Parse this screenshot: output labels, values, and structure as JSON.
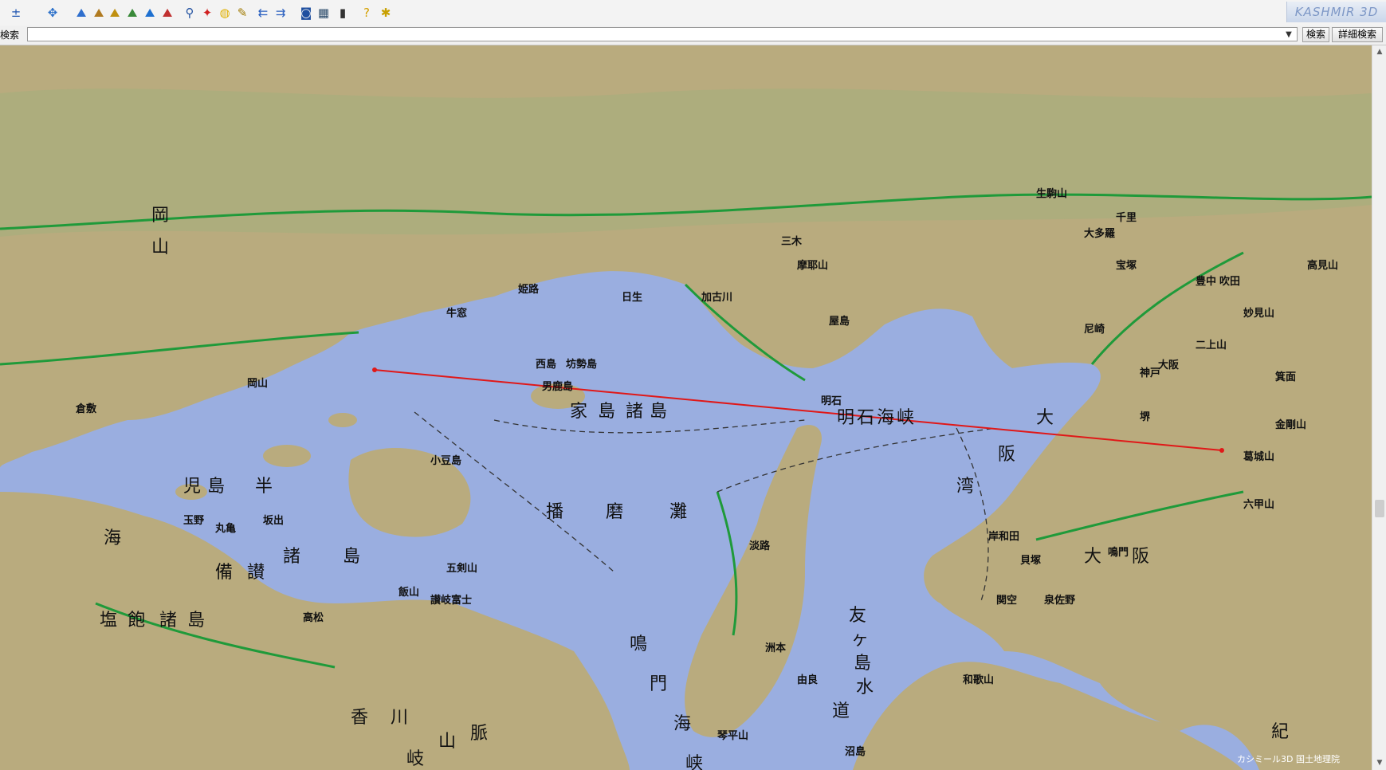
{
  "toolbar": {
    "buttons": [
      {
        "icon": "zoom-search-icon",
        "glyph": "±",
        "color": "#1f55b0",
        "label": ""
      },
      {
        "icon": "cursor-icon",
        "glyph": "✥",
        "color": "#2a6fc9",
        "label": ""
      },
      {
        "icon": "terrain-view-1-icon",
        "glyph": "⛰",
        "color": "#2f6fcd",
        "label": ""
      },
      {
        "icon": "terrain-view-2-icon",
        "glyph": "⛰",
        "color": "#b07a20",
        "label": ""
      },
      {
        "icon": "terrain-view-3-icon",
        "glyph": "⛰",
        "color": "#c09010",
        "label": ""
      },
      {
        "icon": "terrain-view-4-icon",
        "glyph": "⛰",
        "color": "#3a8a3a",
        "label": ""
      },
      {
        "icon": "terrain-view-5-icon",
        "glyph": "⛰",
        "color": "#1e70d0",
        "label": ""
      },
      {
        "icon": "terrain-view-6-icon",
        "glyph": "⛰",
        "color": "#c03030",
        "label": ""
      },
      {
        "icon": "binoculars-icon",
        "glyph": "⚲",
        "color": "#2050a0",
        "label": ""
      },
      {
        "icon": "paint-icon",
        "glyph": "✦",
        "color": "#d02020",
        "label": ""
      },
      {
        "icon": "palette-icon",
        "glyph": "◍",
        "color": "#e0b000",
        "label": ""
      },
      {
        "icon": "pencil-icon",
        "glyph": "✎",
        "color": "#a07a00",
        "label": ""
      },
      {
        "icon": "back-arrow-icon",
        "glyph": "⇇",
        "color": "#2a60c0",
        "label": ""
      },
      {
        "icon": "forward-arrow-icon",
        "glyph": "⇉",
        "color": "#2a60c0",
        "label": ""
      },
      {
        "icon": "camera-icon",
        "glyph": "◙",
        "color": "#1f4f9f",
        "label": ""
      },
      {
        "icon": "film-icon",
        "glyph": "▦",
        "color": "#2a4a6a",
        "label": ""
      },
      {
        "icon": "device-icon",
        "glyph": "▮",
        "color": "#333333",
        "label": ""
      },
      {
        "icon": "help-icon",
        "glyph": "?",
        "color": "#d4a000",
        "label": ""
      },
      {
        "icon": "run-icon",
        "glyph": "✱",
        "color": "#c8a000",
        "label": ""
      }
    ],
    "brand": "KASHMIR 3D"
  },
  "search": {
    "label": "検索",
    "value": "",
    "placeholder": "",
    "search_button": "検索",
    "advanced_button": "詳細検索"
  },
  "map": {
    "colors": {
      "sea": "#9aaee0",
      "land": "#b9ab7e",
      "land_dark": "#8f8a5c",
      "forest": "#9fb07c",
      "road_green": "#1f9a3a",
      "route": "#e01818",
      "label": "#111111"
    },
    "region_labels": [
      "岡",
      "山",
      "児",
      "島",
      "半",
      "海",
      "塩",
      "飽",
      "諸",
      "島",
      "備",
      "讃",
      "諸",
      "島",
      "香",
      "川",
      "家",
      "島",
      "諸",
      "島",
      "播",
      "磨",
      "灘",
      "明",
      "石",
      "海",
      "峡",
      "大",
      "阪",
      "湾",
      "鳴",
      "門",
      "海",
      "峡",
      "友",
      "ヶ",
      "島",
      "水",
      "道",
      "大",
      "阪",
      "紀",
      "讃",
      "岐",
      "山",
      "脈"
    ],
    "place_labels": [
      "岡山",
      "高松",
      "大阪",
      "和歌山",
      "明石",
      "神戸",
      "淡路",
      "洲本",
      "鳴門",
      "小豆島",
      "坂出",
      "丸亀",
      "倉敷",
      "玉野",
      "姫路",
      "加古川",
      "三木",
      "宝塚",
      "尼崎",
      "堺",
      "岸和田",
      "貝塚",
      "泉佐野",
      "関空",
      "由良",
      "沼島",
      "牛窓",
      "日生",
      "男鹿島",
      "西島",
      "坊勢島",
      "大多羅",
      "琴平山",
      "讃岐富士",
      "飯山",
      "五剣山",
      "屋島",
      "摩耶山",
      "六甲山",
      "金剛山",
      "葛城山",
      "二上山",
      "妙見山",
      "箕面",
      "生駒山",
      "高見山",
      "千里",
      "豊中",
      "吹田"
    ],
    "attribution": "カシミール3D 国土地理院"
  }
}
